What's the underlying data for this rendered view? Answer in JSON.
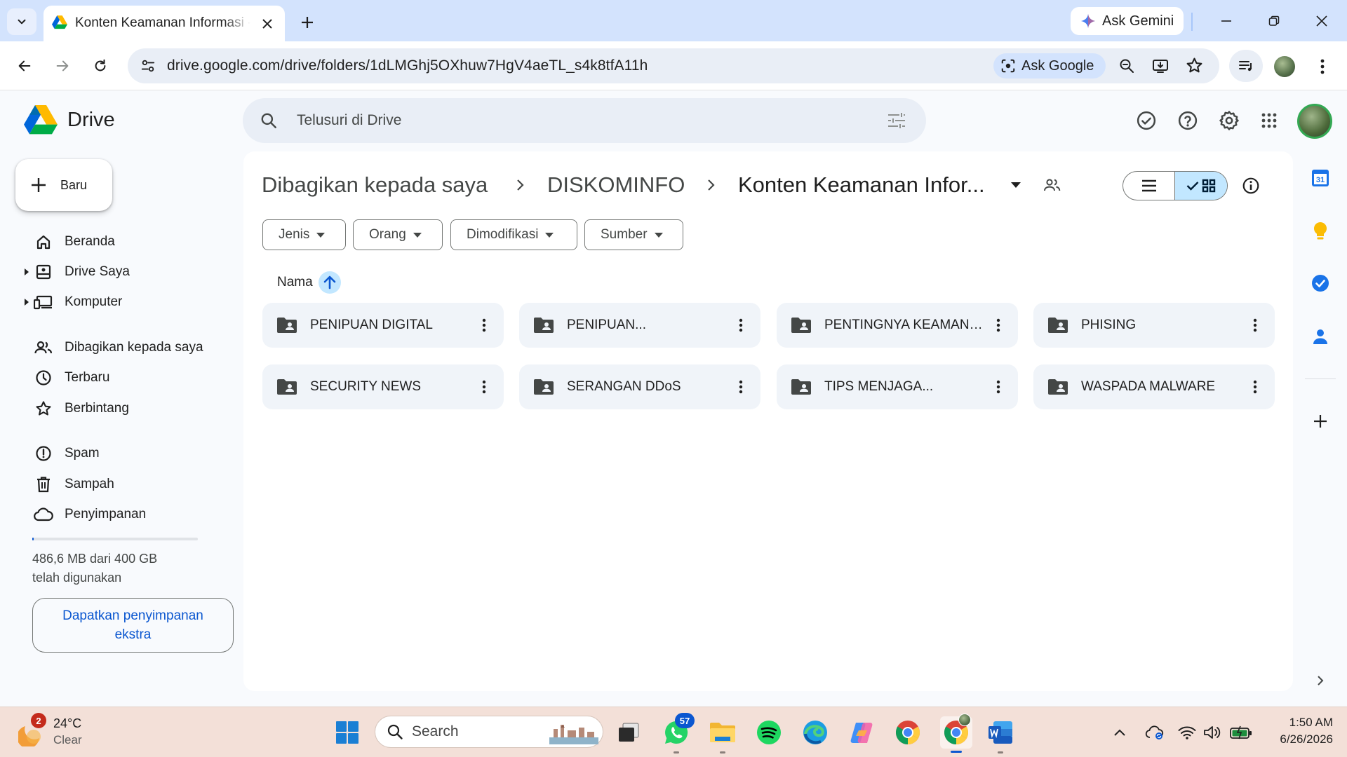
{
  "browser": {
    "tab_title": "Konten Keamanan Informasi - Google Drive",
    "url": "drive.google.com/drive/folders/1dLMGhj5OXhuw7HgV4aeTL_s4k8tfA11h",
    "ask_gemini": "Ask Gemini",
    "ask_google": "Ask Google"
  },
  "drive": {
    "app_name": "Drive",
    "search_placeholder": "Telusuri di Drive"
  },
  "sidebar": {
    "new_label": "Baru",
    "items": [
      {
        "label": "Beranda",
        "icon": "home-icon"
      },
      {
        "label": "Drive Saya",
        "icon": "my-drive-icon"
      },
      {
        "label": "Komputer",
        "icon": "computers-icon"
      },
      {
        "label": "Dibagikan kepada saya",
        "icon": "shared-icon"
      },
      {
        "label": "Terbaru",
        "icon": "clock-icon"
      },
      {
        "label": "Berbintang",
        "icon": "star-icon"
      },
      {
        "label": "Spam",
        "icon": "spam-icon"
      },
      {
        "label": "Sampah",
        "icon": "trash-icon"
      },
      {
        "label": "Penyimpanan",
        "icon": "cloud-icon"
      }
    ],
    "storage_used_fraction": 0.0012,
    "storage_text_line1": "486,6 MB dari 400 GB",
    "storage_text_line2": "telah digunakan",
    "get_storage_line1": "Dapatkan penyimpanan",
    "get_storage_line2": "ekstra"
  },
  "breadcrumb": {
    "items": [
      "Dibagikan kepada saya",
      "DISKOMINFO",
      "Konten Keamanan Infor..."
    ]
  },
  "filters": [
    "Jenis",
    "Orang",
    "Dimodifikasi",
    "Sumber"
  ],
  "sort": {
    "label": "Nama",
    "direction": "ascending"
  },
  "folders": [
    "PENIPUAN DIGITAL",
    "PENIPUAN...",
    "PENTINGNYA KEAMANA...",
    "PHISING",
    "SECURITY NEWS",
    "SERANGAN DDoS",
    "TIPS MENJAGA...",
    "WASPADA MALWARE"
  ],
  "side_panel": {
    "calendar_day": "31"
  },
  "taskbar": {
    "weather_badge": "2",
    "weather_temp": "24°C",
    "weather_desc": "Clear",
    "search_label": "Search",
    "whatsapp_badge": "57",
    "time": "1:50 AM",
    "date": "6/26/2026"
  },
  "colors": {
    "accent": "#0b57d0",
    "selected_view": "#c2e7ff",
    "folder_card": "#f0f4f9",
    "tabstrip": "#d3e3fd",
    "taskbar": "#f3e0d8"
  }
}
